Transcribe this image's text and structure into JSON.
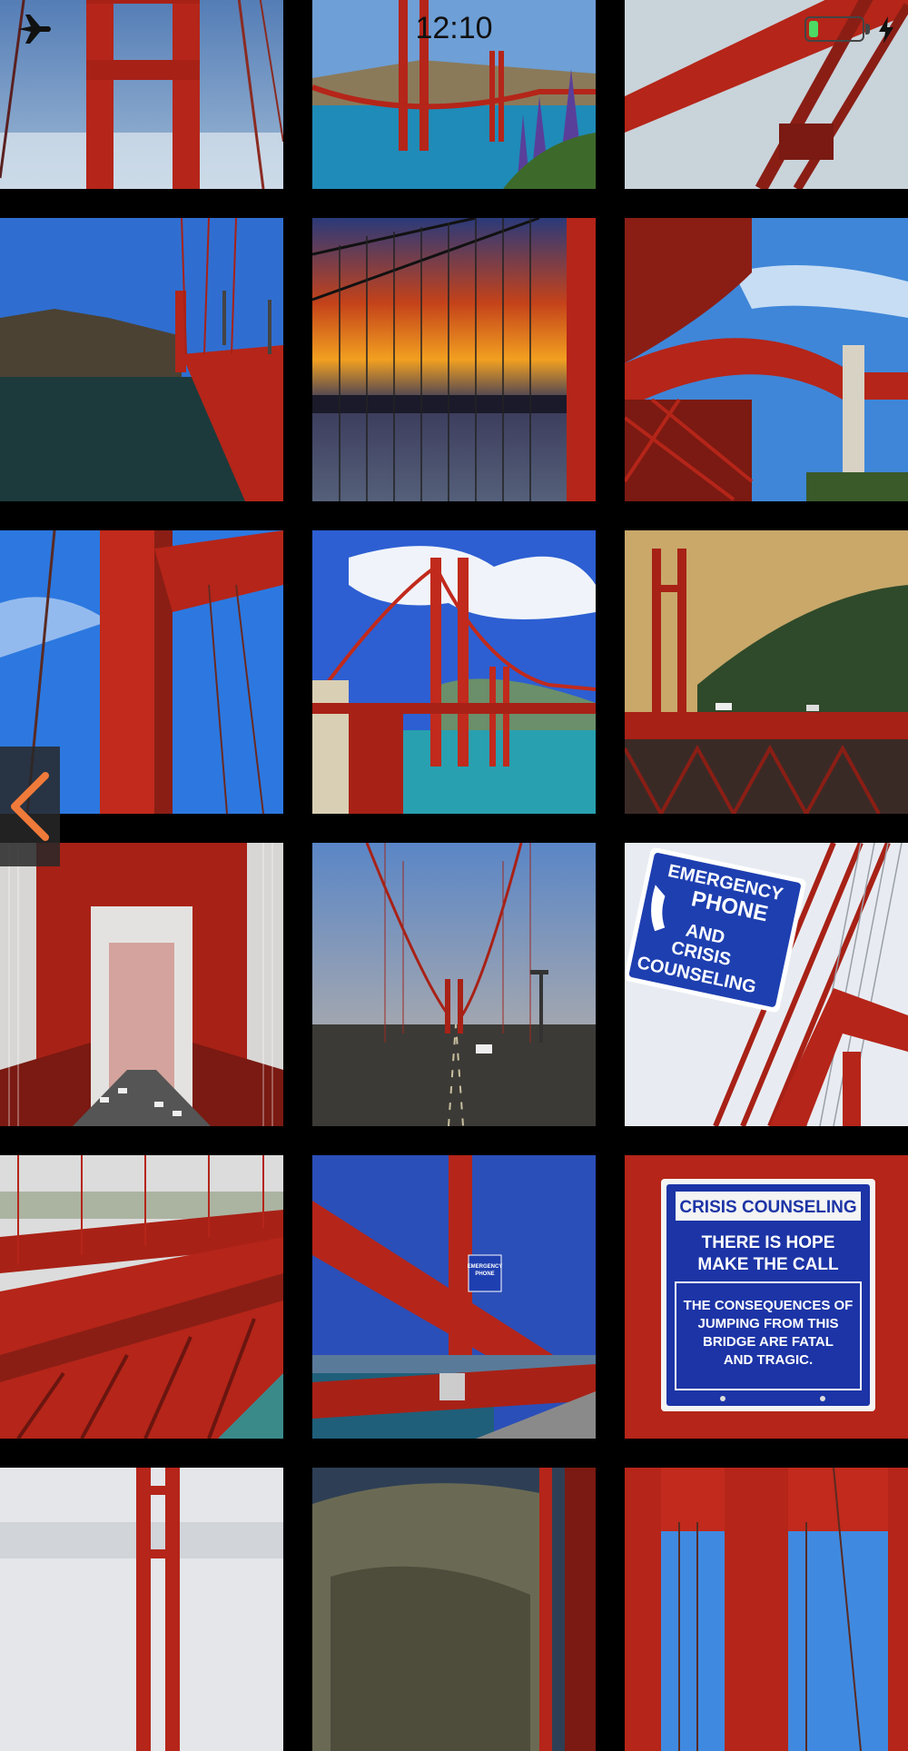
{
  "status_bar": {
    "time": "12:10",
    "airplane_mode": true,
    "battery_level": 0.18,
    "charging": true,
    "battery_color": "#4cd964"
  },
  "navigation": {
    "back_icon": "chevron-left-icon",
    "accent_color": "#f07a3a"
  },
  "gallery": {
    "columns": 3,
    "photo_count": 18
  },
  "signs": {
    "emergency": [
      "EMERGENCY",
      "PHONE",
      "AND",
      "CRISIS",
      "COUNSELING"
    ],
    "crisis_title": "CRISIS COUNSELING",
    "crisis_hope_1": "THERE IS HOPE",
    "crisis_hope_2": "MAKE THE CALL",
    "crisis_warning_1": "THE CONSEQUENCES OF",
    "crisis_warning_2": "JUMPING FROM THIS",
    "crisis_warning_3": "BRIDGE ARE FATAL",
    "crisis_warning_4": "AND TRAGIC.",
    "phone_box": [
      "EMERGENCY",
      "PHONE"
    ]
  }
}
